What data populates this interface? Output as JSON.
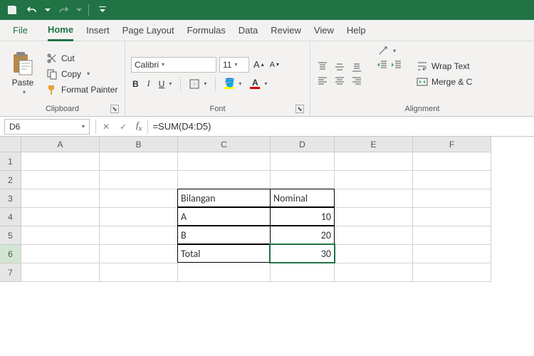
{
  "tabs": {
    "file": "File",
    "home": "Home",
    "insert": "Insert",
    "page_layout": "Page Layout",
    "formulas": "Formulas",
    "data": "Data",
    "review": "Review",
    "view": "View",
    "help": "Help"
  },
  "clipboard": {
    "paste": "Paste",
    "cut": "Cut",
    "copy": "Copy",
    "format_painter": "Format Painter",
    "group": "Clipboard"
  },
  "font": {
    "name": "Calibri",
    "size": "11",
    "group": "Font",
    "bold": "B",
    "italic": "I",
    "underline": "U"
  },
  "alignment": {
    "group": "Alignment",
    "wrap": "Wrap Text",
    "merge": "Merge & C"
  },
  "namebox": "D6",
  "formula": "=SUM(D4:D5)",
  "chart_data": {
    "type": "table",
    "columns": [
      "A",
      "B",
      "C",
      "D",
      "E",
      "F"
    ],
    "rows": [
      "1",
      "2",
      "3",
      "4",
      "5",
      "6",
      "7"
    ],
    "cells": {
      "C3": "Bilangan",
      "D3": "Nominal",
      "C4": "A",
      "D4": "10",
      "C5": "B",
      "D5": "20",
      "C6": "Total",
      "D6": "30"
    },
    "selected": "D6"
  }
}
